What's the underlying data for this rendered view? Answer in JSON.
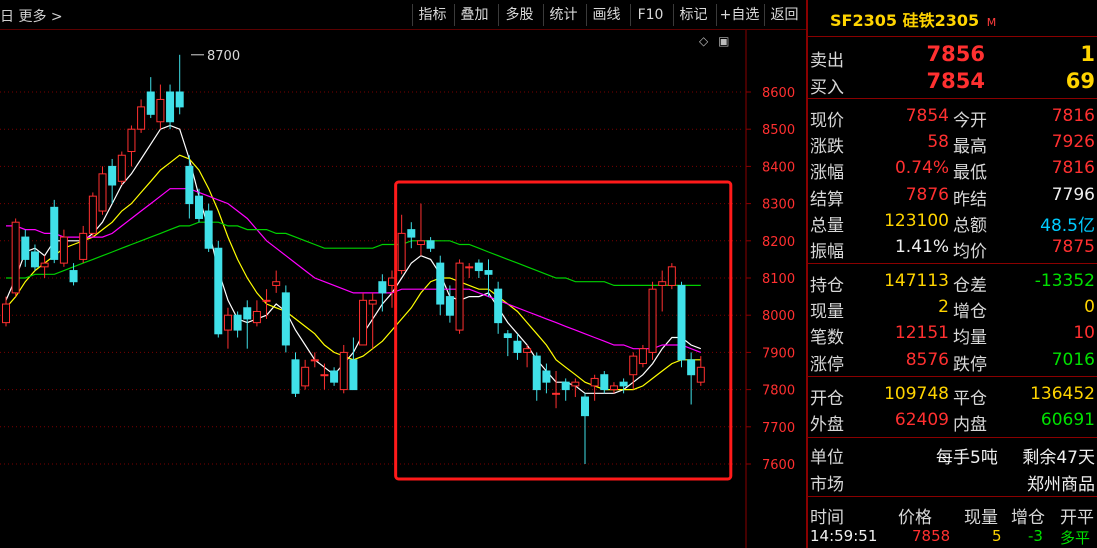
{
  "toolbar": {
    "more": "日 更多 >",
    "buttons": [
      "指标",
      "叠加",
      "多股",
      "统计",
      "画线",
      "F10",
      "标记",
      "+自选",
      "返回"
    ],
    "icons": [
      "diamond-icon",
      "window-icon"
    ]
  },
  "chart_data": {
    "type": "candlestick",
    "title": "",
    "ylim": [
      7550,
      8680
    ],
    "y_ticks": [
      "8600",
      "8500",
      "8400",
      "8300",
      "8200",
      "8100",
      "8000",
      "7900",
      "7800",
      "7700",
      "7600"
    ],
    "y_tick_values": [
      8600,
      8500,
      8400,
      8300,
      8200,
      8100,
      8000,
      7900,
      7800,
      7700,
      7600
    ],
    "grid": true,
    "peak_label": "8700",
    "peak_value": 8700,
    "candles": [
      [
        7980,
        8030,
        7970,
        8050
      ],
      [
        8060,
        8250,
        8050,
        8260
      ],
      [
        8210,
        8150,
        8130,
        8230
      ],
      [
        8170,
        8130,
        8120,
        8190
      ],
      [
        8130,
        8140,
        8100,
        8160
      ],
      [
        8290,
        8150,
        8140,
        8310
      ],
      [
        8140,
        8210,
        8130,
        8230
      ],
      [
        8120,
        8090,
        8080,
        8140
      ],
      [
        8150,
        8220,
        8140,
        8240
      ],
      [
        8220,
        8320,
        8210,
        8330
      ],
      [
        8280,
        8380,
        8270,
        8400
      ],
      [
        8400,
        8350,
        8300,
        8420
      ],
      [
        8360,
        8430,
        8350,
        8440
      ],
      [
        8440,
        8500,
        8400,
        8510
      ],
      [
        8500,
        8560,
        8490,
        8580
      ],
      [
        8600,
        8540,
        8530,
        8640
      ],
      [
        8520,
        8580,
        8500,
        8620
      ],
      [
        8600,
        8520,
        8500,
        8620
      ],
      [
        8600,
        8560,
        8540,
        8700
      ],
      [
        8400,
        8300,
        8260,
        8430
      ],
      [
        8320,
        8260,
        8250,
        8340
      ],
      [
        8280,
        8180,
        8170,
        8300
      ],
      [
        8180,
        7950,
        7940,
        8200
      ],
      [
        7960,
        8000,
        7910,
        8020
      ],
      [
        8000,
        7960,
        7940,
        8010
      ],
      [
        8020,
        7990,
        7910,
        8040
      ],
      [
        7980,
        8010,
        7970,
        8040
      ],
      [
        8040,
        8040,
        7990,
        8070
      ],
      [
        8080,
        8090,
        8060,
        8120
      ],
      [
        8060,
        7920,
        7900,
        8080
      ],
      [
        7880,
        7790,
        7780,
        7900
      ],
      [
        7810,
        7860,
        7800,
        7880
      ],
      [
        7880,
        7880,
        7860,
        7900
      ],
      [
        7840,
        7840,
        7800,
        7870
      ],
      [
        7850,
        7820,
        7810,
        7860
      ],
      [
        7800,
        7900,
        7790,
        7920
      ],
      [
        7880,
        7800,
        7800,
        7940
      ],
      [
        7920,
        8040,
        7920,
        8060
      ],
      [
        8030,
        8040,
        7910,
        8060
      ],
      [
        8090,
        8060,
        8010,
        8110
      ],
      [
        8080,
        8100,
        8020,
        8120
      ],
      [
        8120,
        8220,
        8110,
        8270
      ],
      [
        8230,
        8210,
        8180,
        8250
      ],
      [
        8190,
        8200,
        8160,
        8300
      ],
      [
        8200,
        8180,
        8170,
        8210
      ],
      [
        8140,
        8030,
        8000,
        8160
      ],
      [
        8050,
        8000,
        7980,
        8080
      ],
      [
        7960,
        8140,
        7950,
        8150
      ],
      [
        8130,
        8130,
        8100,
        8140
      ],
      [
        8140,
        8120,
        8100,
        8150
      ],
      [
        8120,
        8110,
        8050,
        8150
      ],
      [
        8070,
        7980,
        7950,
        8090
      ],
      [
        7950,
        7940,
        7890,
        7960
      ],
      [
        7930,
        7900,
        7880,
        7950
      ],
      [
        7900,
        7910,
        7860,
        7920
      ],
      [
        7890,
        7800,
        7770,
        7900
      ],
      [
        7850,
        7820,
        7790,
        7870
      ],
      [
        7790,
        7790,
        7750,
        7850
      ],
      [
        7820,
        7800,
        7770,
        7830
      ],
      [
        7810,
        7820,
        7780,
        7830
      ],
      [
        7780,
        7730,
        7600,
        7790
      ],
      [
        7810,
        7830,
        7770,
        7840
      ],
      [
        7840,
        7800,
        7790,
        7850
      ],
      [
        7800,
        7810,
        7790,
        7820
      ],
      [
        7820,
        7810,
        7790,
        7830
      ],
      [
        7840,
        7890,
        7800,
        7900
      ],
      [
        7870,
        7910,
        7860,
        7920
      ],
      [
        7900,
        8070,
        7880,
        8090
      ],
      [
        8080,
        8090,
        8010,
        8120
      ],
      [
        8080,
        8130,
        8070,
        8140
      ],
      [
        8080,
        7880,
        7860,
        8090
      ],
      [
        7880,
        7840,
        7760,
        7900
      ],
      [
        7820,
        7860,
        7810,
        7890
      ]
    ],
    "series": [
      {
        "name": "",
        "color": "#ffffff",
        "values": [
          8040,
          8100,
          8170,
          8180,
          8160,
          8200,
          8200,
          8200,
          8200,
          8220,
          8250,
          8300,
          8350,
          8380,
          8420,
          8460,
          8500,
          8510,
          8500,
          8420,
          8320,
          8230,
          8120,
          8040,
          7990,
          7980,
          7990,
          8000,
          8030,
          8010,
          7960,
          7920,
          7880,
          7860,
          7840,
          7870,
          7900,
          7950,
          7990,
          8030,
          8060,
          8100,
          8140,
          8160,
          8150,
          8110,
          8050,
          8040,
          8050,
          8050,
          8060,
          8020,
          7980,
          7950,
          7920,
          7880,
          7850,
          7820,
          7820,
          7810,
          7790,
          7790,
          7790,
          7790,
          7800,
          7820,
          7840,
          7870,
          7910,
          7940,
          7940,
          7920,
          7910
        ]
      },
      {
        "name": "",
        "color": "#ffff00",
        "values": [
          8020,
          8050,
          8090,
          8120,
          8140,
          8160,
          8180,
          8190,
          8200,
          8210,
          8230,
          8250,
          8280,
          8300,
          8330,
          8360,
          8390,
          8410,
          8430,
          8420,
          8390,
          8340,
          8280,
          8210,
          8150,
          8100,
          8060,
          8030,
          8020,
          8010,
          7990,
          7970,
          7950,
          7920,
          7900,
          7890,
          7880,
          7890,
          7910,
          7930,
          7960,
          7990,
          8020,
          8060,
          8090,
          8100,
          8100,
          8090,
          8080,
          8070,
          8070,
          8050,
          8030,
          8010,
          7980,
          7950,
          7920,
          7880,
          7860,
          7840,
          7820,
          7810,
          7800,
          7800,
          7800,
          7800,
          7810,
          7830,
          7850,
          7870,
          7880,
          7880,
          7880
        ]
      },
      {
        "name": "",
        "color": "#ff00ff",
        "values": [
          8240,
          8240,
          8230,
          8230,
          8220,
          8220,
          8210,
          8210,
          8210,
          8210,
          8210,
          8220,
          8240,
          8260,
          8280,
          8300,
          8320,
          8340,
          8340,
          8340,
          8330,
          8320,
          8310,
          8300,
          8280,
          8260,
          8230,
          8200,
          8180,
          8160,
          8140,
          8120,
          8100,
          8090,
          8080,
          8070,
          8060,
          8060,
          8060,
          8060,
          8060,
          8070,
          8070,
          8070,
          8070,
          8070,
          8070,
          8070,
          8070,
          8060,
          8050,
          8040,
          8030,
          8020,
          8010,
          8000,
          7990,
          7980,
          7970,
          7960,
          7950,
          7940,
          7930,
          7920,
          7920,
          7910,
          7910,
          7910,
          7920,
          7920,
          7920,
          7910,
          7900
        ]
      },
      {
        "name": "",
        "color": "#00d000",
        "values": [
          8100,
          8100,
          8100,
          8110,
          8110,
          8110,
          8120,
          8130,
          8140,
          8150,
          8160,
          8170,
          8180,
          8190,
          8200,
          8210,
          8220,
          8230,
          8240,
          8240,
          8250,
          8250,
          8250,
          8240,
          8240,
          8230,
          8230,
          8230,
          8220,
          8220,
          8210,
          8200,
          8190,
          8180,
          8180,
          8180,
          8180,
          8180,
          8180,
          8190,
          8190,
          8190,
          8200,
          8200,
          8200,
          8200,
          8200,
          8190,
          8190,
          8180,
          8170,
          8160,
          8150,
          8140,
          8130,
          8120,
          8110,
          8100,
          8100,
          8090,
          8090,
          8090,
          8090,
          8080,
          8080,
          8080,
          8080,
          8080,
          8080,
          8080,
          8080,
          8080,
          8080
        ]
      }
    ],
    "highlight_box": {
      "from_index": 41,
      "to_index": 72
    }
  },
  "panel": {
    "symbol": "SF2305",
    "name": "硅铁2305",
    "market_tag": "M",
    "quotes": [
      {
        "label": "卖出",
        "price": "7856",
        "vol": "1"
      },
      {
        "label": "买入",
        "price": "7854",
        "vol": "69"
      }
    ],
    "stats1": [
      {
        "l1": "现价",
        "v1": "7854",
        "c1": "red",
        "l2": "今开",
        "v2": "7816",
        "c2": "red"
      },
      {
        "l1": "涨跌",
        "v1": "58",
        "c1": "red",
        "l2": "最高",
        "v2": "7926",
        "c2": "red"
      },
      {
        "l1": "涨幅",
        "v1": "0.74%",
        "c1": "red",
        "l2": "最低",
        "v2": "7816",
        "c2": "red"
      },
      {
        "l1": "结算",
        "v1": "7876",
        "c1": "red",
        "l2": "昨结",
        "v2": "7796",
        "c2": "white"
      },
      {
        "l1": "总量",
        "v1": "123100",
        "c1": "yellow",
        "l2": "总额",
        "v2": "48.5亿",
        "c2": "cyan"
      },
      {
        "l1": "振幅",
        "v1": "1.41%",
        "c1": "white",
        "l2": "均价",
        "v2": "7875",
        "c2": "red"
      }
    ],
    "stats2": [
      {
        "l1": "持仓",
        "v1": "147113",
        "c1": "yellow",
        "l2": "仓差",
        "v2": "-13352",
        "c2": "green"
      },
      {
        "l1": "现量",
        "v1": "2",
        "c1": "yellow",
        "l2": "增仓",
        "v2": "0",
        "c2": "yellow"
      },
      {
        "l1": "笔数",
        "v1": "12151",
        "c1": "red",
        "l2": "均量",
        "v2": "10",
        "c2": "red"
      },
      {
        "l1": "涨停",
        "v1": "8576",
        "c1": "red",
        "l2": "跌停",
        "v2": "7016",
        "c2": "green"
      }
    ],
    "stats3": [
      {
        "l1": "开仓",
        "v1": "109748",
        "c1": "yellow",
        "l2": "平仓",
        "v2": "136452",
        "c2": "yellow"
      },
      {
        "l1": "外盘",
        "v1": "62409",
        "c1": "red",
        "l2": "内盘",
        "v2": "60691",
        "c2": "green"
      }
    ],
    "unit_label": "单位",
    "unit_value": "每手5吨",
    "remain": "剩余47天",
    "market_label": "市场",
    "market_value": "郑州商品",
    "trades_header": [
      "时间",
      "价格",
      "现量",
      "增仓",
      "开平"
    ],
    "trade": {
      "time": "14:59:51",
      "price": "7858",
      "vol": "5",
      "oi": "-3",
      "type": "多平"
    },
    "colors": {
      "up": "#ff3030",
      "down": "#40e0e8",
      "accent": "#ffd400"
    }
  }
}
